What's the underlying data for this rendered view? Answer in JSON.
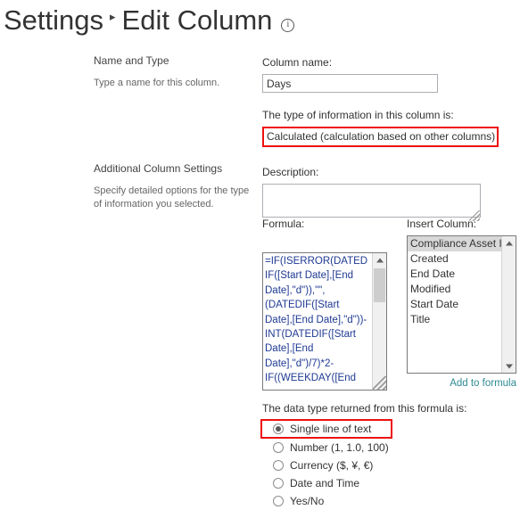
{
  "header": {
    "breadcrumb_parent": "Settings",
    "breadcrumb_separator": "▸",
    "breadcrumb_current": "Edit Column",
    "info_icon": "info-icon"
  },
  "sections": [
    {
      "title": "Name and Type",
      "description": "Type a name for this column."
    },
    {
      "title": "Additional Column Settings",
      "description": "Specify detailed options for the type of information you selected."
    }
  ],
  "form": {
    "column_name_label": "Column name:",
    "column_name_value": "Days",
    "type_label": "The type of information in this column is:",
    "type_value": "Calculated (calculation based on other columns)",
    "description_label": "Description:",
    "description_value": "",
    "formula_label": "Formula:",
    "formula_value": "=IF(ISERROR(DATEDIF([Start Date],[End Date],\"d\")),\"\",(DATEDIF([Start Date],[End Date],\"d\"))-INT(DATEDIF([Start Date],[End Date],\"d\")/7)*2-IF((WEEKDAY([End",
    "insert_column_label": "Insert Column:",
    "insert_column_items": [
      "Compliance Asset Id",
      "Created",
      "End Date",
      "Modified",
      "Start Date",
      "Title"
    ],
    "insert_column_selected": "Compliance Asset Id",
    "add_to_formula_label": "Add to formula",
    "data_type_label": "The data type returned from this formula is:",
    "data_type_options": [
      "Single line of text",
      "Number (1, 1.0, 100)",
      "Currency ($, ¥, €)",
      "Date and Time",
      "Yes/No"
    ],
    "data_type_selected": "Single line of text"
  },
  "colors": {
    "highlight_red": "#ee1111",
    "link_teal": "#2e8b94",
    "formula_text": "#1f3a93"
  }
}
